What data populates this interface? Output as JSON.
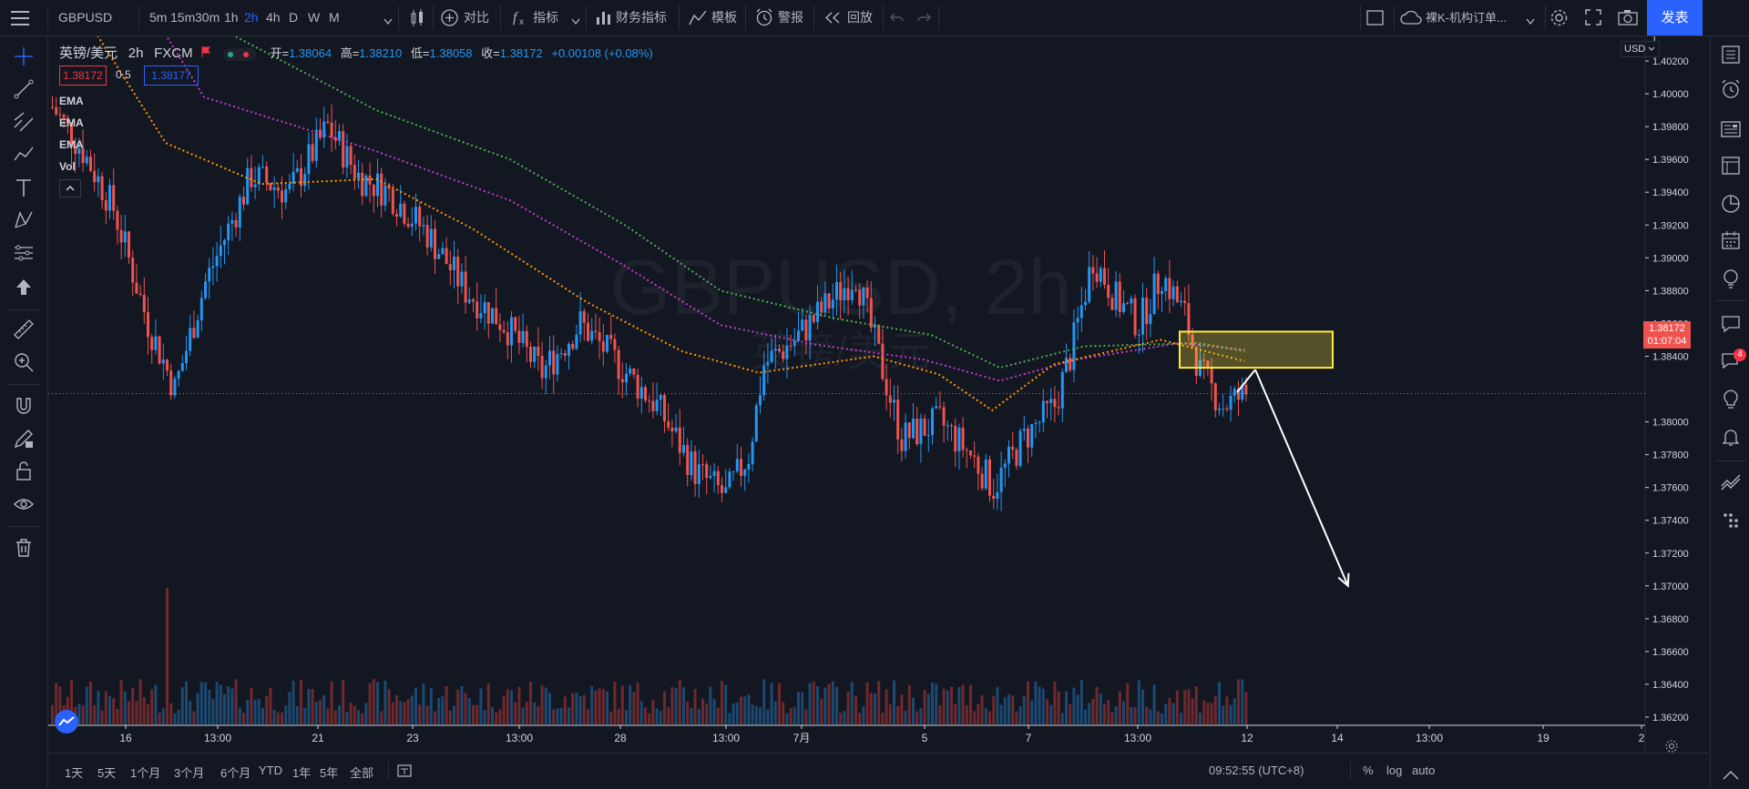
{
  "toolbar": {
    "symbol": "GBPUSD",
    "intervals": [
      "5m",
      "15m",
      "30m",
      "1h",
      "2h",
      "4h",
      "D",
      "W",
      "M"
    ],
    "active_interval": "2h",
    "compare_label": "对比",
    "indicators_label": "指标",
    "financials_label": "财务指标",
    "templates_label": "模板",
    "alerts_label": "警报",
    "replay_label": "回放",
    "layout_name": "裸K-机构订单...",
    "publish_label": "发表"
  },
  "legend": {
    "title": "英镑/美元",
    "interval": "2h",
    "source": "FXCM",
    "open_label": "开=",
    "open": "1.38064",
    "high_label": "高=",
    "high": "1.38210",
    "low_label": "低=",
    "low": "1.38058",
    "close_label": "收=",
    "close": "1.38172",
    "change": "+0.00108 (+0.08%)",
    "bid": "1.38172",
    "spread": "0.5",
    "ask": "1.38177",
    "indicators": [
      "EMA",
      "EMA",
      "EMA",
      "Vol"
    ]
  },
  "watermark": {
    "symbol": "GBPUSD, 2h",
    "name": "英镑/美元"
  },
  "price_axis": {
    "currency": "USD",
    "top_label": "1",
    "labels": [
      "1.40200",
      "1.40000",
      "1.39800",
      "1.39600",
      "1.39400",
      "1.39200",
      "1.39000",
      "1.38800",
      "1.38600",
      "1.38400",
      "1.38000",
      "1.37800",
      "1.37600",
      "1.37400",
      "1.37200",
      "1.37000",
      "1.36800",
      "1.36600",
      "1.36400",
      "1.36200"
    ],
    "last_price": "1.38172",
    "countdown": "01:07:04"
  },
  "time_axis": {
    "labels": [
      "16",
      "13:00",
      "21",
      "23",
      "13:00",
      "28",
      "13:00",
      "7月",
      "5",
      "7",
      "13:00",
      "12",
      "14",
      "13:00",
      "19",
      "2"
    ]
  },
  "bottom": {
    "ranges": [
      "1天",
      "5天",
      "1个月",
      "3个月",
      "6个月",
      "YTD",
      "1年",
      "5年",
      "全部"
    ],
    "clock": "09:52:55 (UTC+8)",
    "percent_label": "%",
    "log_label": "log",
    "auto_label": "auto"
  },
  "notifications": {
    "count": "4"
  },
  "colors": {
    "background": "#131722",
    "up": "#2196f3",
    "down": "#ef5350",
    "ema_fast": "#ff9800",
    "ema_mid": "#c13ccf",
    "ema_slow": "#4caf50",
    "accent": "#2962ff",
    "zone": "#ffeb3b"
  },
  "chart_data": {
    "type": "candlestick",
    "symbol": "GBPUSD",
    "interval": "2h",
    "ylim": [
      1.3615,
      1.4035
    ],
    "y_ticks": [
      1.402,
      1.4,
      1.398,
      1.396,
      1.394,
      1.392,
      1.39,
      1.388,
      1.386,
      1.384,
      1.38,
      1.378,
      1.376,
      1.374,
      1.372,
      1.37,
      1.368,
      1.366,
      1.364,
      1.362
    ],
    "price_path": [
      [
        0,
        1.3992
      ],
      [
        8,
        1.3965
      ],
      [
        16,
        1.393
      ],
      [
        25,
        1.386
      ],
      [
        32,
        1.382
      ],
      [
        40,
        1.3885
      ],
      [
        52,
        1.395
      ],
      [
        62,
        1.394
      ],
      [
        72,
        1.398
      ],
      [
        80,
        1.395
      ],
      [
        88,
        1.394
      ],
      [
        98,
        1.3915
      ],
      [
        108,
        1.388
      ],
      [
        118,
        1.386
      ],
      [
        128,
        1.383
      ],
      [
        138,
        1.386
      ],
      [
        148,
        1.3835
      ],
      [
        158,
        1.381
      ],
      [
        168,
        1.377
      ],
      [
        176,
        1.3755
      ],
      [
        182,
        1.378
      ],
      [
        186,
        1.3835
      ],
      [
        194,
        1.385
      ],
      [
        202,
        1.387
      ],
      [
        210,
        1.389
      ],
      [
        216,
        1.384
      ],
      [
        222,
        1.379
      ],
      [
        232,
        1.38
      ],
      [
        240,
        1.378
      ],
      [
        246,
        1.376
      ],
      [
        254,
        1.379
      ],
      [
        262,
        1.381
      ],
      [
        266,
        1.384
      ],
      [
        272,
        1.39
      ],
      [
        278,
        1.3875
      ],
      [
        284,
        1.386
      ],
      [
        290,
        1.389
      ],
      [
        296,
        1.3865
      ],
      [
        300,
        1.383
      ],
      [
        306,
        1.381
      ],
      [
        312,
        1.3817
      ]
    ],
    "ema_fast": [
      [
        0,
        1.408
      ],
      [
        30,
        1.397
      ],
      [
        55,
        1.3945
      ],
      [
        85,
        1.3948
      ],
      [
        110,
        1.3918
      ],
      [
        140,
        1.3873
      ],
      [
        165,
        1.3843
      ],
      [
        185,
        1.383
      ],
      [
        215,
        1.384
      ],
      [
        232,
        1.3829
      ],
      [
        246,
        1.3807
      ],
      [
        262,
        1.3835
      ],
      [
        290,
        1.385
      ],
      [
        312,
        1.3837
      ]
    ],
    "ema_mid": [
      [
        0,
        1.415
      ],
      [
        40,
        1.3998
      ],
      [
        85,
        1.3965
      ],
      [
        120,
        1.3935
      ],
      [
        150,
        1.3895
      ],
      [
        175,
        1.3859
      ],
      [
        200,
        1.3847
      ],
      [
        228,
        1.3838
      ],
      [
        248,
        1.3825
      ],
      [
        268,
        1.3838
      ],
      [
        295,
        1.3848
      ],
      [
        312,
        1.3844
      ]
    ],
    "ema_slow": [
      [
        0,
        1.418
      ],
      [
        40,
        1.4045
      ],
      [
        85,
        1.399
      ],
      [
        120,
        1.396
      ],
      [
        150,
        1.392
      ],
      [
        175,
        1.388
      ],
      [
        205,
        1.3863
      ],
      [
        230,
        1.3853
      ],
      [
        248,
        1.3833
      ],
      [
        270,
        1.3846
      ],
      [
        300,
        1.3848
      ],
      [
        312,
        1.3843
      ]
    ],
    "zone": {
      "from_bar": 295,
      "to_bar": 335,
      "y_top": 1.3855,
      "y_bottom": 1.3833
    },
    "arrow": {
      "from_bar": 310,
      "from_y": 1.3818,
      "to_bar": 339,
      "to_y": 1.37
    },
    "volume_peak_bar": 30
  }
}
